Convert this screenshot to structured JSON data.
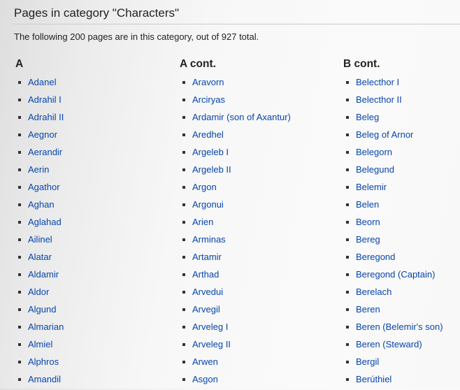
{
  "category": {
    "heading": "Pages in category \"Characters\"",
    "summary": "The following 200 pages are in this category, out of 927 total."
  },
  "columns": [
    {
      "heading": "A",
      "items": [
        "Adanel",
        "Adrahil I",
        "Adrahil II",
        "Aegnor",
        "Aerandir",
        "Aerin",
        "Agathor",
        "Aghan",
        "Aglahad",
        "Ailinel",
        "Alatar",
        "Aldamir",
        "Aldor",
        "Algund",
        "Almarian",
        "Almiel",
        "Alphros",
        "Amandil"
      ]
    },
    {
      "heading": "A cont.",
      "items": [
        "Aravorn",
        "Arciryas",
        "Ardamir (son of Axantur)",
        "Aredhel",
        "Argeleb I",
        "Argeleb II",
        "Argon",
        "Argonui",
        "Arien",
        "Arminas",
        "Artamir",
        "Arthad",
        "Arvedui",
        "Arvegil",
        "Arveleg I",
        "Arveleg II",
        "Arwen",
        "Asgon"
      ]
    },
    {
      "heading": "B cont.",
      "items": [
        "Belecthor I",
        "Belecthor II",
        "Beleg",
        "Beleg of Arnor",
        "Belegorn",
        "Belegund",
        "Belemir",
        "Belen",
        "Beorn",
        "Bereg",
        "Beregond",
        "Beregond (Captain)",
        "Berelach",
        "Beren",
        "Beren (Belemir's son)",
        "Beren (Steward)",
        "Bergil",
        "Berúthiel"
      ]
    }
  ],
  "colors": {
    "link": "#0645ad",
    "text": "#222222",
    "rule": "#c8ccd1"
  }
}
